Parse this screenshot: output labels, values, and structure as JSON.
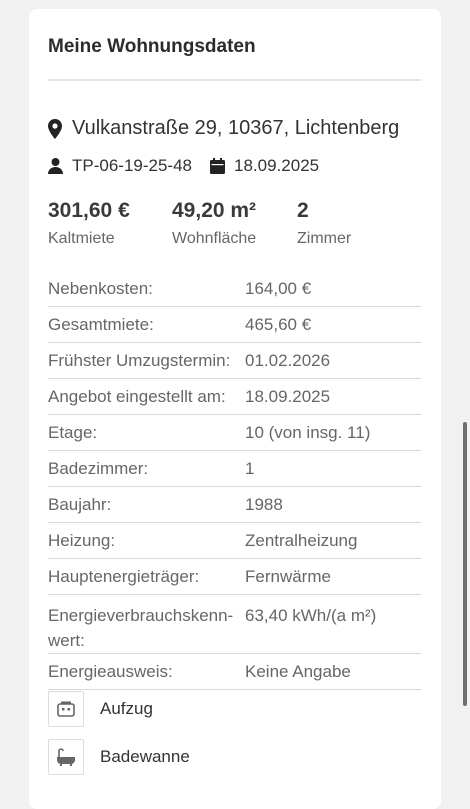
{
  "section_title": "Meine Wohnungsdaten",
  "address": "Vulkanstraße 29, 10367, Lichtenberg",
  "listing_id": "TP-06-19-25-48",
  "listing_date": "18.09.2025",
  "stats": [
    {
      "value": "301,60 €",
      "label": "Kaltmiete"
    },
    {
      "value": "49,20 m²",
      "label": "Wohnfläche"
    },
    {
      "value": "2",
      "label": "Zimmer"
    }
  ],
  "details": [
    {
      "key": "Nebenkosten:",
      "value": "164,00 €"
    },
    {
      "key": "Gesamtmiete:",
      "value": "465,60 €"
    },
    {
      "key": "Frühster Umzugstermin:",
      "value": "01.02.2026"
    },
    {
      "key": "Angebot eingestellt am:",
      "value": "18.09.2025"
    },
    {
      "key": "Etage:",
      "value": "10 (von insg. 11)"
    },
    {
      "key": "Badezimmer:",
      "value": "1"
    },
    {
      "key": "Baujahr:",
      "value": "1988"
    },
    {
      "key": "Heizung:",
      "value": "Zentralheizung"
    },
    {
      "key": "Hauptenergieträger:",
      "value": "Fernwärme"
    },
    {
      "key": "Energieverbrauchskenn-wert:",
      "value": "63,40 kWh/(a m²)"
    },
    {
      "key": "Energieausweis:",
      "value": "Keine Angabe"
    }
  ],
  "features": [
    {
      "label": "Aufzug",
      "icon": "elevator-icon"
    },
    {
      "label": "Badewanne",
      "icon": "bathtub-icon"
    }
  ],
  "colors": {
    "background": "#f1f1f1",
    "card": "#ffffff",
    "text": "#333333",
    "muted": "#666666",
    "divider": "#d8d8d8"
  }
}
